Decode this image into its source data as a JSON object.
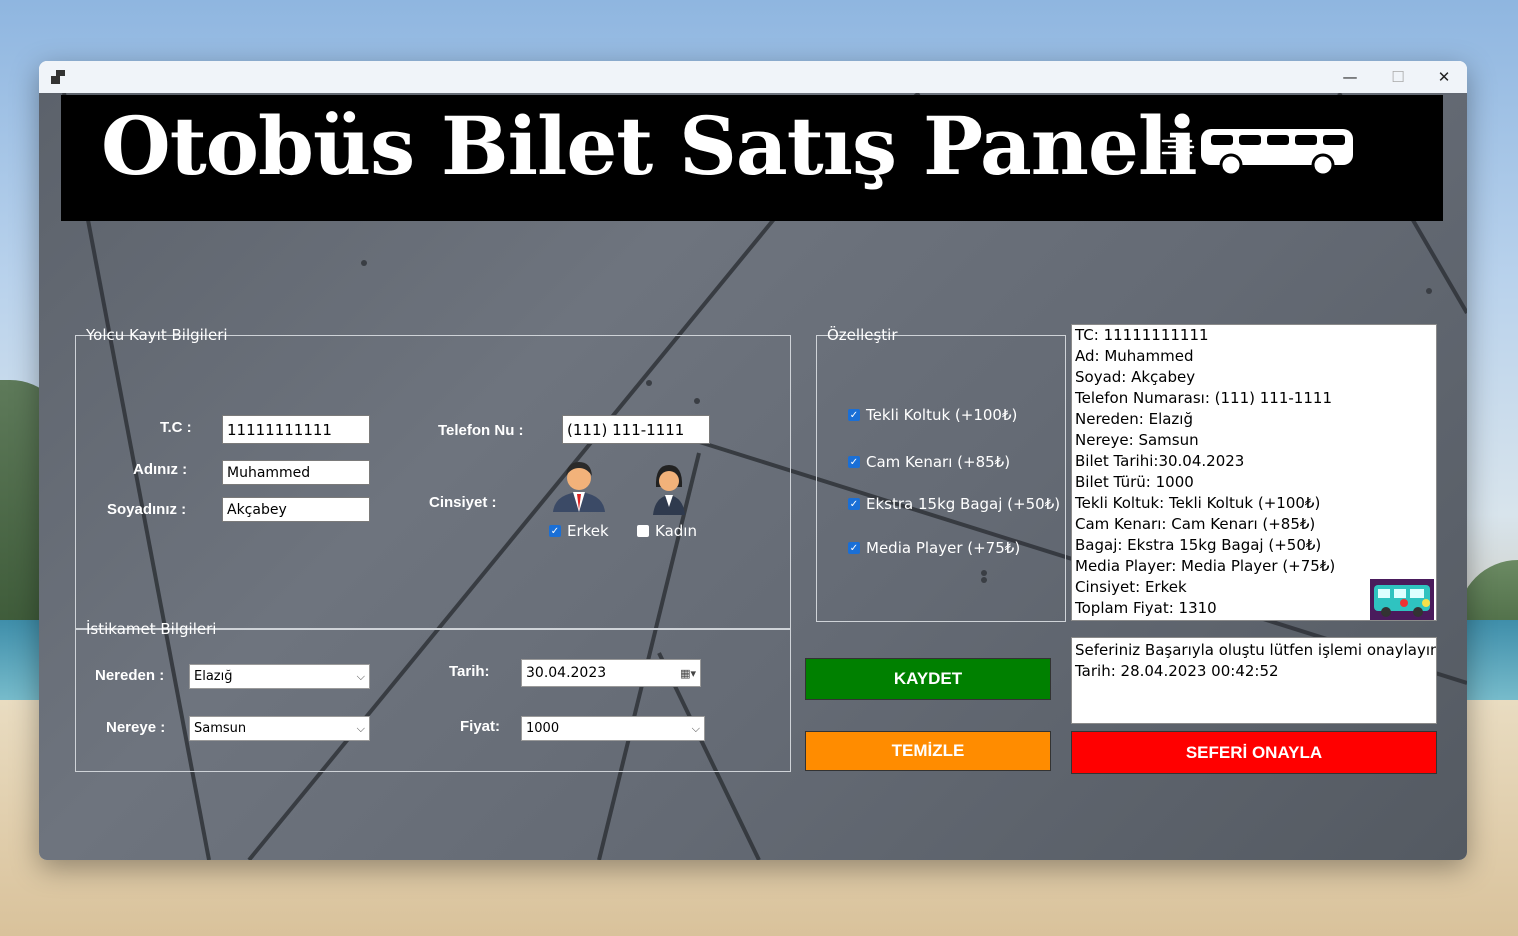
{
  "window": {
    "minimize": "—",
    "maximize": "☐",
    "close": "✕"
  },
  "header": {
    "title": "Otobüs Bilet Satış Paneli",
    "icon": "bus-icon"
  },
  "passenger_group": {
    "legend": "Yolcu Kayıt Bilgileri",
    "tc_label": "T.C :",
    "tc_value": "11111111111",
    "name_label": "Adınız :",
    "name_value": "Muhammed",
    "surname_label": "Soyadınız :",
    "surname_value": "Akçabey",
    "phone_label": "Telefon Nu :",
    "phone_value": "(111) 111-1111",
    "gender_label": "Cinsiyet :",
    "male_label": "Erkek",
    "male_checked": true,
    "female_label": "Kadın",
    "female_checked": false
  },
  "route_group": {
    "legend": "İstikamet Bilgileri",
    "from_label": "Nereden :",
    "from_value": "Elazığ",
    "to_label": "Nereye :",
    "to_value": "Samsun",
    "date_label": "Tarih:",
    "date_value": "30.04.2023",
    "price_label": "Fiyat:",
    "price_value": "1000"
  },
  "custom_group": {
    "legend": "Özelleştir",
    "options": [
      {
        "label": "Tekli Koltuk (+100₺)",
        "checked": true
      },
      {
        "label": "Cam Kenarı (+85₺)",
        "checked": true
      },
      {
        "label": "Ekstra 15kg Bagaj (+50₺)",
        "checked": true
      },
      {
        "label": "Media Player (+75₺)",
        "checked": true
      }
    ]
  },
  "summary_lines": [
    "TC: 11111111111",
    "Ad: Muhammed",
    "Soyad: Akçabey",
    "Telefon Numarası: (111) 111-1111",
    "Nereden: Elazığ",
    "Nereye: Samsun",
    "Bilet Tarihi:30.04.2023",
    "Bilet Türü: 1000",
    "Tekli Koltuk: Tekli Koltuk (+100₺)",
    "Cam Kenarı: Cam Kenarı (+85₺)",
    "Bagaj: Ekstra 15kg Bagaj (+50₺)",
    "Media Player: Media Player (+75₺)",
    "Cinsiyet: Erkek",
    "Toplam Fiyat: 1310"
  ],
  "status_lines": [
    "Seferiniz Başarıyla oluştu lütfen işlemi onaylayın",
    "Tarih: 28.04.2023 00:42:52"
  ],
  "buttons": {
    "save": "KAYDET",
    "clear": "TEMİZLE",
    "confirm": "SEFERİ ONAYLA"
  },
  "colors": {
    "save": "#008000",
    "clear": "#ff8c00",
    "confirm": "#ff0000"
  }
}
